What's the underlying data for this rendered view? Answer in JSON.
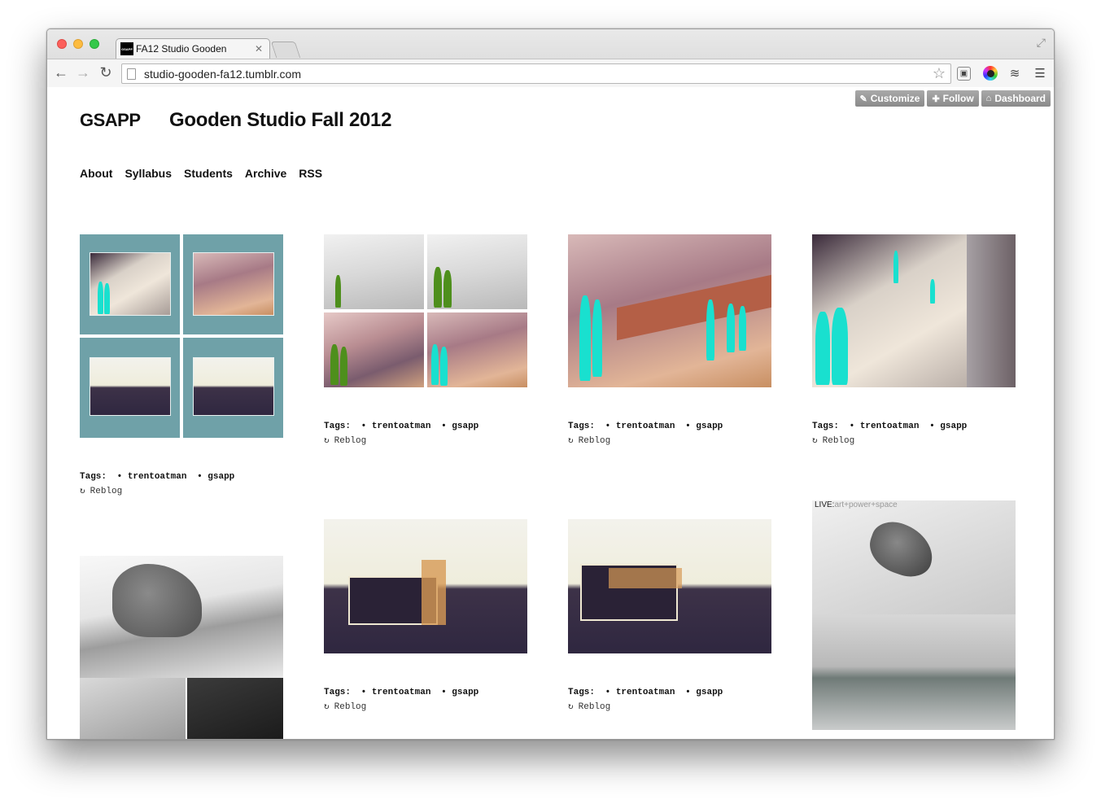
{
  "browser": {
    "tab_title": "FA12 Studio Gooden",
    "favicon_text": "GSAPP",
    "url": "studio-gooden-fa12.tumblr.com"
  },
  "tumblr_controls": {
    "customize": "Customize",
    "follow": "Follow",
    "dashboard": "Dashboard"
  },
  "site": {
    "brand": "GSAPP",
    "title": "Gooden Studio Fall 2012",
    "nav": [
      "About",
      "Syllabus",
      "Students",
      "Archive",
      "RSS"
    ]
  },
  "posts": [
    {
      "tags_label": "Tags:",
      "tags": [
        "• trentoatman",
        "• gsapp"
      ],
      "reblog": "Reblog"
    },
    {
      "tags_label": "Tags:",
      "tags": [
        "• trentoatman",
        "• gsapp"
      ],
      "reblog": "Reblog"
    },
    {
      "tags_label": "Tags:",
      "tags": [
        "• trentoatman",
        "• gsapp"
      ],
      "reblog": "Reblog"
    },
    {
      "tags_label": "Tags:",
      "tags": [
        "• trentoatman",
        "• gsapp"
      ],
      "reblog": "Reblog"
    },
    {
      "tags_label": "Tags:",
      "tags": [
        "• trentoatman",
        "• gsapp"
      ],
      "reblog": "Reblog"
    },
    {
      "tags_label": "Tags:",
      "tags": [
        "• trentoatman",
        "• gsapp"
      ],
      "reblog": "Reblog"
    }
  ],
  "live_image": {
    "label": "LIVE:",
    "subtitle": "art+power+space"
  },
  "icons": {
    "back": "arrow-left-icon",
    "forward": "arrow-right-icon",
    "reload": "reload-icon",
    "star": "star-icon",
    "menu": "hamburger-icon"
  }
}
